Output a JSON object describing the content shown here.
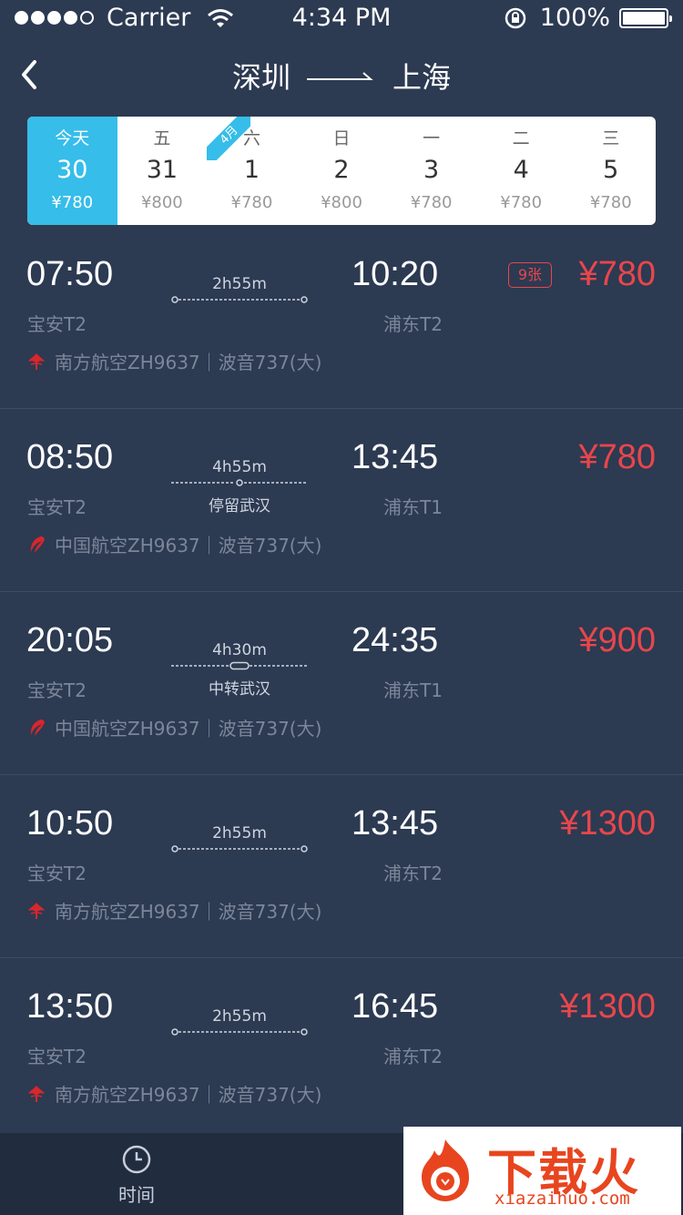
{
  "status": {
    "carrier": "Carrier",
    "time": "4:34 PM",
    "battery": "100%"
  },
  "nav": {
    "from": "深圳",
    "to": "上海"
  },
  "dates": [
    {
      "weekday": "今天",
      "day": "30",
      "price": "¥780",
      "selected": true
    },
    {
      "weekday": "五",
      "day": "31",
      "price": "¥800"
    },
    {
      "weekday": "六",
      "day": "1",
      "price": "¥780",
      "month_flag": "4月"
    },
    {
      "weekday": "日",
      "day": "2",
      "price": "¥800"
    },
    {
      "weekday": "一",
      "day": "3",
      "price": "¥780"
    },
    {
      "weekday": "二",
      "day": "4",
      "price": "¥780"
    },
    {
      "weekday": "三",
      "day": "5",
      "price": "¥780"
    }
  ],
  "flights": [
    {
      "dep_time": "07:50",
      "dep_airport": "宝安T2",
      "duration": "2h55m",
      "stop_note": "",
      "stop_type": "direct",
      "arr_time": "10:20",
      "arr_airport": "浦东T2",
      "airline": "南方航空ZH9637｜波音737(大)",
      "airline_logo": "china-southern-logo",
      "price": "¥780",
      "seats": "9张"
    },
    {
      "dep_time": "08:50",
      "dep_airport": "宝安T2",
      "duration": "4h55m",
      "stop_note": "停留武汉",
      "stop_type": "stop",
      "arr_time": "13:45",
      "arr_airport": "浦东T1",
      "airline": "中国航空ZH9637｜波音737(大)",
      "airline_logo": "air-china-logo",
      "price": "¥780",
      "seats": ""
    },
    {
      "dep_time": "20:05",
      "dep_airport": "宝安T2",
      "duration": "4h30m",
      "stop_note": "中转武汉",
      "stop_type": "transfer",
      "arr_time": "24:35",
      "arr_airport": "浦东T1",
      "airline": "中国航空ZH9637｜波音737(大)",
      "airline_logo": "air-china-logo",
      "price": "¥900",
      "seats": ""
    },
    {
      "dep_time": "10:50",
      "dep_airport": "宝安T2",
      "duration": "2h55m",
      "stop_note": "",
      "stop_type": "direct",
      "arr_time": "13:45",
      "arr_airport": "浦东T2",
      "airline": "南方航空ZH9637｜波音737(大)",
      "airline_logo": "china-southern-logo",
      "price": "¥1300",
      "seats": ""
    },
    {
      "dep_time": "13:50",
      "dep_airport": "宝安T2",
      "duration": "2h55m",
      "stop_note": "",
      "stop_type": "direct",
      "arr_time": "16:45",
      "arr_airport": "浦东T2",
      "airline": "南方航空ZH9637｜波音737(大)",
      "airline_logo": "china-southern-logo",
      "price": "¥1300",
      "seats": ""
    }
  ],
  "tabbar": {
    "time_label": "时间"
  },
  "watermark": {
    "brand": "下载火",
    "url": "xiazaihuo.com"
  },
  "colors": {
    "background": "#2c3a52",
    "accent": "#36bde9",
    "price": "#e8464b",
    "tabbar": "#212c3f"
  }
}
